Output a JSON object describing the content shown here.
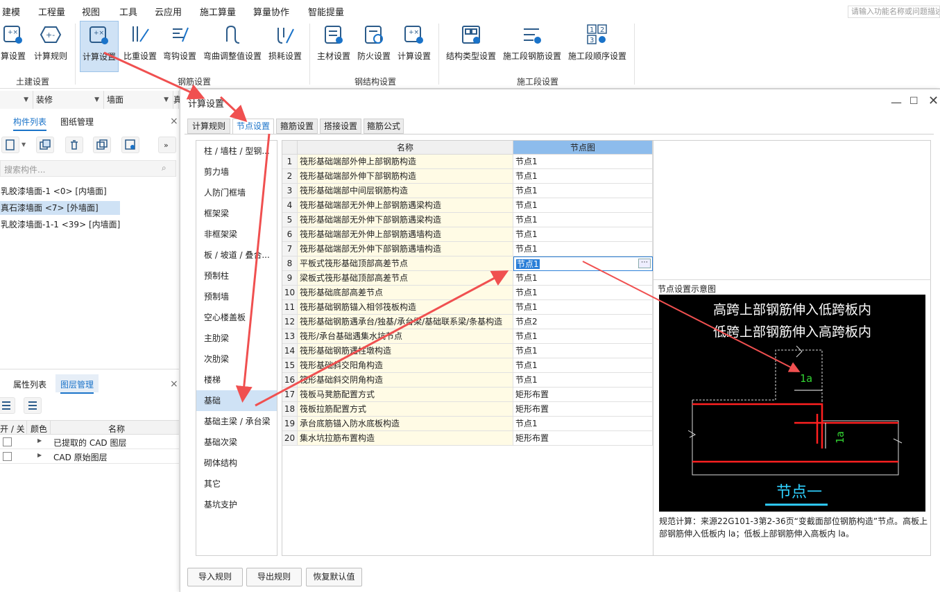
{
  "menu": [
    "建模",
    "工程量",
    "视图",
    "工具",
    "云应用",
    "施工算量",
    "算量协作",
    "智能提量"
  ],
  "search_placeholder": "请输入功能名称或问题描述",
  "ribbon": {
    "buttons": [
      "算设置",
      "计算规则",
      "计算设置",
      "比重设置",
      "弯钩设置",
      "弯曲调整值设置",
      "损耗设置",
      "主材设置",
      "防火设置",
      "计算设置",
      "结构类型设置",
      "施工段钢筋设置",
      "施工段顺序设置"
    ],
    "groups": [
      "土建设置",
      "钢筋设置",
      "钢结构设置",
      "施工段设置"
    ]
  },
  "left": {
    "combos": [
      "装修",
      "墙面",
      "真"
    ],
    "tabs": [
      "构件列表",
      "图纸管理"
    ],
    "search_placeholder": "搜索构件...",
    "components": [
      "乳胶漆墙面-1 <0> [内墙面]",
      "真石漆墙面 <7> [外墙面]",
      "乳胶漆墙面-1-1 <39> [内墙面]"
    ],
    "bottom_tabs": [
      "属性列表",
      "图层管理"
    ],
    "layer_headers": [
      "开 / 关",
      "颜色",
      "名称"
    ],
    "layers": [
      "已提取的 CAD 图层",
      "CAD 原始图层"
    ]
  },
  "dialog": {
    "title": "计算设置",
    "tabs": [
      "计算规则",
      "节点设置",
      "箍筋设置",
      "搭接设置",
      "箍筋公式"
    ],
    "categories": [
      "柱 / 墙柱 / 型钢...",
      "剪力墙",
      "人防门框墙",
      "框架梁",
      "非框架梁",
      "板 / 坡道 / 叠合...",
      "预制柱",
      "预制墙",
      "空心楼盖板",
      "主肋梁",
      "次肋梁",
      "楼梯",
      "基础",
      "基础主梁 / 承台梁",
      "基础次梁",
      "砌体结构",
      "其它",
      "基坑支护"
    ],
    "grid_headers": [
      "名称",
      "节点图"
    ],
    "rows": [
      {
        "n": "1",
        "name": "筏形基础端部外伸上部钢筋构造",
        "val": "节点1"
      },
      {
        "n": "2",
        "name": "筏形基础端部外伸下部钢筋构造",
        "val": "节点1"
      },
      {
        "n": "3",
        "name": "筏形基础端部中间层钢筋构造",
        "val": "节点1"
      },
      {
        "n": "4",
        "name": "筏形基础端部无外伸上部钢筋遇梁构造",
        "val": "节点1"
      },
      {
        "n": "5",
        "name": "筏形基础端部无外伸下部钢筋遇梁构造",
        "val": "节点1"
      },
      {
        "n": "6",
        "name": "筏形基础端部无外伸上部钢筋遇墙构造",
        "val": "节点1"
      },
      {
        "n": "7",
        "name": "筏形基础端部无外伸下部钢筋遇墙构造",
        "val": "节点1"
      },
      {
        "n": "8",
        "name": "平板式筏形基础顶部高差节点",
        "val": "节点1"
      },
      {
        "n": "9",
        "name": "梁板式筏形基础顶部高差节点",
        "val": "节点1"
      },
      {
        "n": "10",
        "name": "筏形基础底部高差节点",
        "val": "节点1"
      },
      {
        "n": "11",
        "name": "筏形基础钢筋锚入相邻筏板构造",
        "val": "节点1"
      },
      {
        "n": "12",
        "name": "筏形基础钢筋遇承台/独基/承台梁/基础联系梁/条基构造",
        "val": "节点2"
      },
      {
        "n": "13",
        "name": "筏形/承台基础遇集水坑节点",
        "val": "节点1"
      },
      {
        "n": "14",
        "name": "筏形基础钢筋遇柱墩构造",
        "val": "节点1"
      },
      {
        "n": "15",
        "name": "筏形基础斜交阳角构造",
        "val": "节点1"
      },
      {
        "n": "16",
        "name": "筏形基础斜交阴角构造",
        "val": "节点1"
      },
      {
        "n": "17",
        "name": "筏板马凳筋配置方式",
        "val": "矩形布置"
      },
      {
        "n": "18",
        "name": "筏板拉筋配置方式",
        "val": "矩形布置"
      },
      {
        "n": "19",
        "name": "承台底筋锚入防水底板构造",
        "val": "节点1"
      },
      {
        "n": "20",
        "name": "集水坑拉筋布置构造",
        "val": "矩形布置"
      }
    ],
    "preview_label": "节点设置示意图",
    "preview_text1": "高跨上部钢筋伸入低跨板内",
    "preview_text2": "低跨上部钢筋伸入高跨板内",
    "preview_dim": "1a",
    "preview_caption": "节点一",
    "description": "规范计算：来源22G101-3第2-36页“变截面部位钢筋构造”节点。高板上部钢筋伸入低板内 la；低板上部钢筋伸入高板内 la。",
    "buttons": [
      "导入规则",
      "导出规则",
      "恢复默认值"
    ]
  }
}
